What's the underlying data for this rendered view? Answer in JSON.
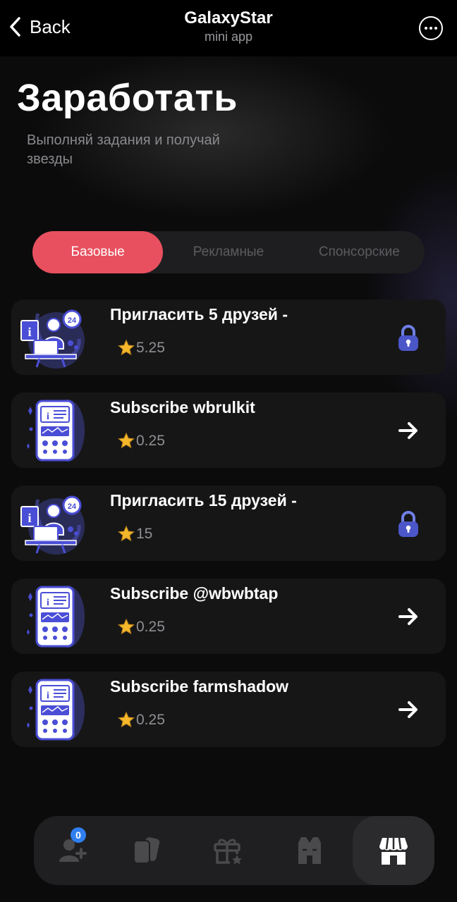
{
  "topbar": {
    "back_label": "Back",
    "app_title": "GalaxyStar",
    "app_subtitle": "mini app"
  },
  "header": {
    "title": "Заработать",
    "subtitle": "Выполняй задания и получай звезды"
  },
  "tabs": [
    {
      "label": "Базовые",
      "active": true
    },
    {
      "label": "Рекламные",
      "active": false
    },
    {
      "label": "Спонсорские",
      "active": false
    }
  ],
  "tasks": [
    {
      "title": "Пригласить 5 друзей -",
      "reward": "5.25",
      "thumb": "support-agent-illustration",
      "action": "lock-icon"
    },
    {
      "title": "Subscribe wbrulkit",
      "reward": "0.25",
      "thumb": "phone-app-illustration",
      "action": "arrow-right-icon"
    },
    {
      "title": "Пригласить 15 друзей -",
      "reward": "15",
      "thumb": "support-agent-illustration",
      "action": "lock-icon"
    },
    {
      "title": "Subscribe @wbwbtap",
      "reward": "0.25",
      "thumb": "phone-app-illustration",
      "action": "arrow-right-icon"
    },
    {
      "title": "Subscribe farmshadow",
      "reward": "0.25",
      "thumb": "phone-app-illustration",
      "action": "arrow-right-icon"
    }
  ],
  "bottom_nav": {
    "items": [
      {
        "icon": "add-friend-icon",
        "badge": "0"
      },
      {
        "icon": "cards-icon"
      },
      {
        "icon": "gift-icon"
      },
      {
        "icon": "vest-icon"
      },
      {
        "icon": "shop-icon",
        "active": true
      }
    ]
  },
  "colors": {
    "accent": "#e8505f",
    "card_bg": "#161617",
    "star": "#f5b72b",
    "illustration": "#4a4ed6"
  }
}
